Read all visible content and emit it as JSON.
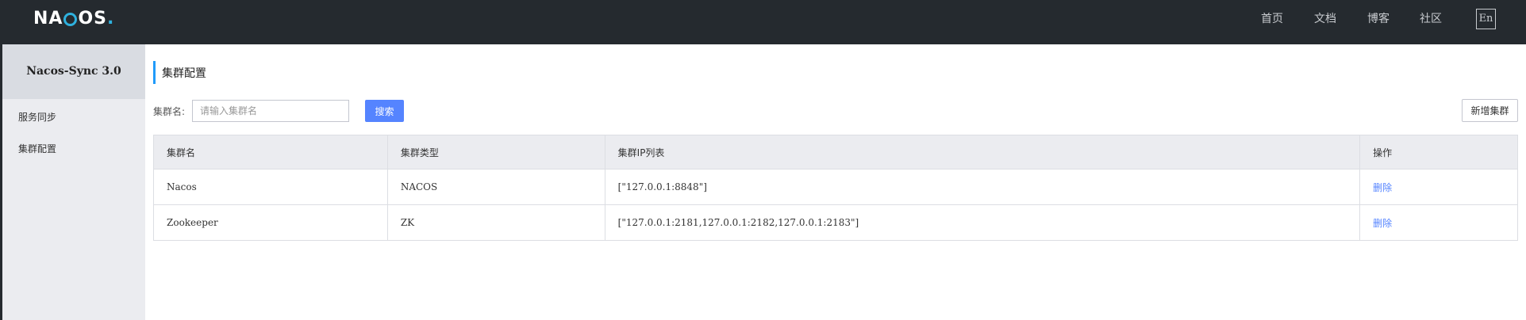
{
  "header": {
    "logo": "NACOS",
    "nav": [
      "首页",
      "文档",
      "博客",
      "社区"
    ],
    "lang_button": "En"
  },
  "sidebar": {
    "title": "Nacos-Sync 3.0",
    "items": [
      {
        "label": "服务同步"
      },
      {
        "label": "集群配置"
      }
    ]
  },
  "main": {
    "title": "集群配置",
    "search": {
      "label": "集群名:",
      "placeholder": "请输入集群名",
      "value": "",
      "button_label": "搜索"
    },
    "add_button_label": "新增集群",
    "table": {
      "columns": [
        "集群名",
        "集群类型",
        "集群IP列表",
        "操作"
      ],
      "rows": [
        {
          "name": "Nacos",
          "type": "NACOS",
          "ips": "[\"127.0.0.1:8848\"]",
          "action": "删除"
        },
        {
          "name": "Zookeeper",
          "type": "ZK",
          "ips": "[\"127.0.0.1:2181,127.0.0.1:2182,127.0.0.1:2183\"]",
          "action": "删除"
        }
      ]
    }
  },
  "colors": {
    "topbar_bg": "#252a2f",
    "sidebar_bg": "#ebecf0",
    "accent": "#5584ff",
    "logo_accent": "#2fb1de",
    "title_bar": "#209bfa"
  }
}
